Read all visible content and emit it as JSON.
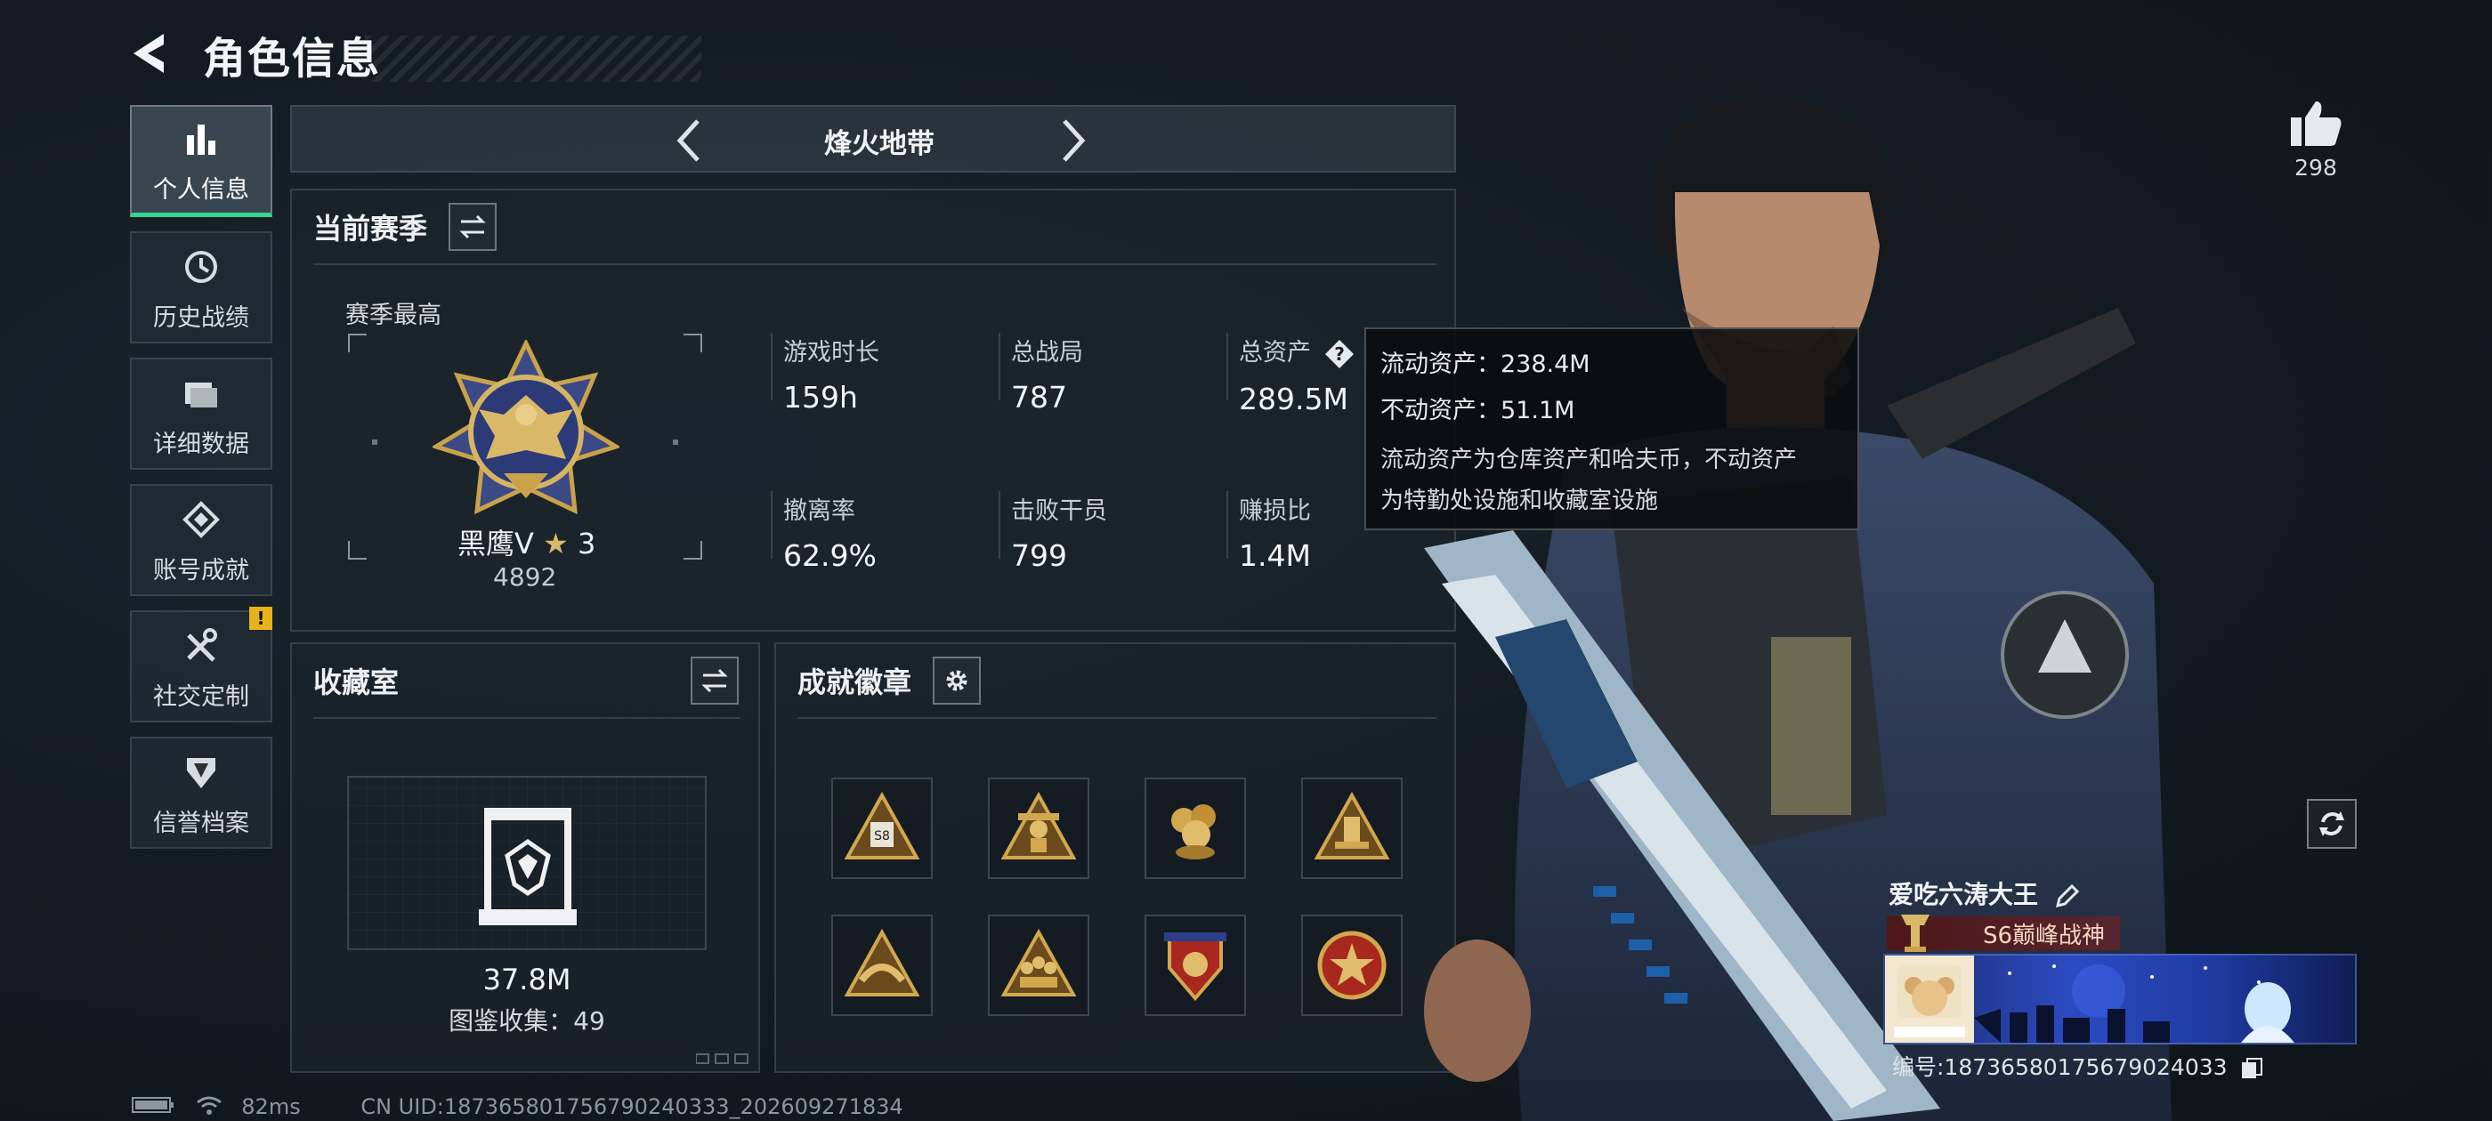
{
  "header": {
    "title": "角色信息"
  },
  "sidebar": {
    "items": [
      {
        "label": "个人信息",
        "active": true,
        "icon": "bar-chart-icon"
      },
      {
        "label": "历史战绩",
        "icon": "history-icon"
      },
      {
        "label": "详细数据",
        "icon": "folder-icon"
      },
      {
        "label": "账号成就",
        "icon": "achievement-icon"
      },
      {
        "label": "社交定制",
        "icon": "tools-icon",
        "alert": "!"
      },
      {
        "label": "信誉档案",
        "icon": "shield-icon"
      }
    ]
  },
  "mode": {
    "title": "烽火地带"
  },
  "season": {
    "title": "当前赛季",
    "best_label": "赛季最高",
    "rank_name": "黑鹰V",
    "rank_stars": "3",
    "rank_score": "4892",
    "stats": [
      {
        "label": "游戏时长",
        "value": "159h"
      },
      {
        "label": "总战局",
        "value": "787"
      },
      {
        "label": "总资产",
        "value": "289.5M",
        "has_help": true
      },
      {
        "label": "撤离率",
        "value": "62.9%"
      },
      {
        "label": "击败干员",
        "value": "799"
      },
      {
        "label": "赚损比",
        "value": "1.4M"
      }
    ]
  },
  "tooltip": {
    "liquid": "流动资产：238.4M",
    "fixed": "不动资产：51.1M",
    "desc_line1": "流动资产为仓库资产和哈夫币，不动资产",
    "desc_line2": "为特勤处设施和收藏室设施"
  },
  "collection": {
    "title": "收藏室",
    "value": "37.8M",
    "catalog": "图鉴收集：49"
  },
  "badges": {
    "title": "成就徽章",
    "items": [
      {
        "icon": "s8-triangle-badge-icon",
        "text": "S8"
      },
      {
        "icon": "soldier-triangle-badge-icon"
      },
      {
        "icon": "gold-ore-badge-icon"
      },
      {
        "icon": "tower-triangle-badge-icon"
      },
      {
        "icon": "hands-triangle-badge-icon"
      },
      {
        "icon": "squad-triangle-badge-icon"
      },
      {
        "icon": "red-shield-badge-icon"
      },
      {
        "icon": "red-star-badge-icon"
      }
    ]
  },
  "like": {
    "count": "298"
  },
  "player": {
    "name": "爱吃六涛大王",
    "rank_title": "S6巅峰战神",
    "id_text": "编号:18736580175679024033"
  },
  "status_bar": {
    "ping": "82ms",
    "uid": "CN UID:187365801756790240333_202609271834"
  },
  "colors": {
    "accent_green": "#34d58f",
    "gold": "#c9a24a",
    "alert_yellow": "#e8b21a"
  }
}
